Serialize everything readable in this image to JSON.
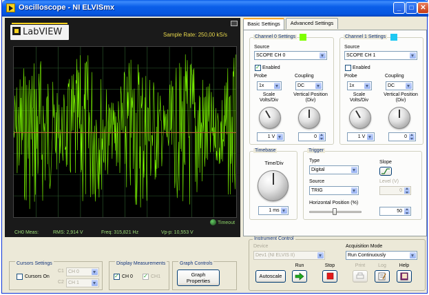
{
  "window": {
    "title": "Oscilloscope - NI ELVISmx",
    "minimize": "_",
    "maximize": "□",
    "close": "✕"
  },
  "scope": {
    "logo": "LabVIEW",
    "sample_rate": "Sample Rate:  250,00 kS/s",
    "timeout_label": "Timeout",
    "meas_label": "CH0 Meas:",
    "rms": "RMS:  2,914 V",
    "freq": "Freq:  315,821 Hz",
    "vpp": "Vp-p:  10,553 V",
    "trace_color": "#7fff00",
    "trigger_line_color": "#b8542a"
  },
  "cursors": {
    "title": "Cursors Settings",
    "on_label": "Cursors On",
    "c1_label": "C1",
    "c1_value": "CH 0",
    "c2_label": "C2",
    "c2_value": "CH 1"
  },
  "display_meas": {
    "title": "Display Measurements",
    "ch0": "CH 0",
    "ch1": "CH1"
  },
  "graph_controls": {
    "title": "Graph Controls",
    "button": "Graph Properties"
  },
  "tabs": [
    {
      "label": "Basic Settings"
    },
    {
      "label": "Advanced Settings"
    }
  ],
  "ch0": {
    "title": "Channel 0 Settings",
    "color": "#7fff00",
    "source_label": "Source",
    "source": "SCOPE CH 0",
    "enabled_label": "Enabled",
    "enabled": true,
    "probe_label": "Probe",
    "probe": "1x",
    "coupling_label": "Coupling",
    "coupling": "DC",
    "scale_label": "Scale Volts/Div",
    "scale": "1 V",
    "vpos_label": "Vertical Position (Div)",
    "vpos": "0"
  },
  "ch1": {
    "title": "Channel 1 Settings",
    "color": "#1ec8f2",
    "source_label": "Source",
    "source": "SCOPE CH 1",
    "enabled_label": "Enabled",
    "enabled": false,
    "probe_label": "Probe",
    "probe": "1x",
    "coupling_label": "Coupling",
    "coupling": "DC",
    "scale_label": "Scale Volts/Div",
    "scale": "1 V",
    "vpos_label": "Vertical Position (Div)",
    "vpos": "0"
  },
  "timebase": {
    "title": "Timebase",
    "label": "Time/Div",
    "value": "1 ms"
  },
  "trigger": {
    "title": "Trigger",
    "type_label": "Type",
    "type": "Digital",
    "slope_label": "Slope",
    "source_label": "Source",
    "source": "TRIG",
    "level_label": "Level (V)",
    "level": "0",
    "hpos_label": "Horizontal Position (%)",
    "hpos": "50"
  },
  "instrument": {
    "title": "Instrument Control",
    "device_label": "Device",
    "device": "Dev1 (NI ELVIS II)",
    "acq_label": "Acquisition Mode",
    "acq": "Run Continuously",
    "autoscale": "Autoscale",
    "run_label": "Run",
    "stop_label": "Stop",
    "print_label": "Print",
    "log_label": "Log",
    "help_label": "Help"
  }
}
